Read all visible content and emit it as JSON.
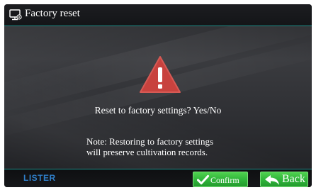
{
  "header": {
    "title": "Factory reset",
    "icon": "monitor-settings-icon"
  },
  "dialog": {
    "icon": "warning-icon",
    "message": "Reset to factory settings? Yes/No",
    "note_lines": [
      "Note: Restoring to factory settings",
      "will preserve cultivation records."
    ]
  },
  "footer": {
    "logo": "LISTER",
    "confirm_label": "Confirm",
    "confirm_icon": "checkmark-icon",
    "back_label": "Back",
    "back_icon": "back-arrow-icon"
  },
  "colors": {
    "accent_line": "#1f8f8a",
    "button_green": "#2fb43a",
    "warning_red": "#c8423e",
    "logo_blue": "#2f7fc9"
  }
}
